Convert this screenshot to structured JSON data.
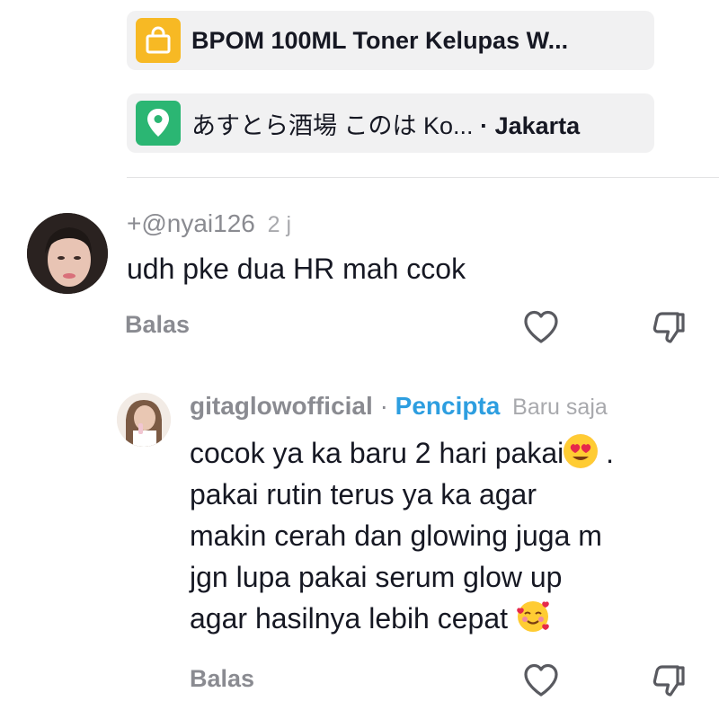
{
  "chips": [
    {
      "icon": "shopping-bag-icon",
      "color": "#f7b924",
      "text": "BPOM 100ML Toner Kelupas W..."
    },
    {
      "icon": "location-pin-icon",
      "color": "#2bb673",
      "place": "あすとら酒場 このは Ko...",
      "separator": "·",
      "city": "Jakarta"
    }
  ],
  "comments": [
    {
      "username": "+@nyai126",
      "time": "2 j",
      "text": "udh pke dua HR mah ccok",
      "reply_label": "Balas"
    },
    {
      "username": "gitaglowofficial",
      "separator": "·",
      "badge": "Pencipta",
      "time": "Baru saja",
      "lines": [
        "cocok ya ka baru 2 hari pakai",
        "pakai rutin terus ya ka agar",
        "makin cerah dan glowing juga m",
        "jgn lupa pakai serum glow up",
        "agar hasilnya lebih cepat"
      ],
      "line1_suffix": " .",
      "reply_label": "Balas"
    }
  ]
}
